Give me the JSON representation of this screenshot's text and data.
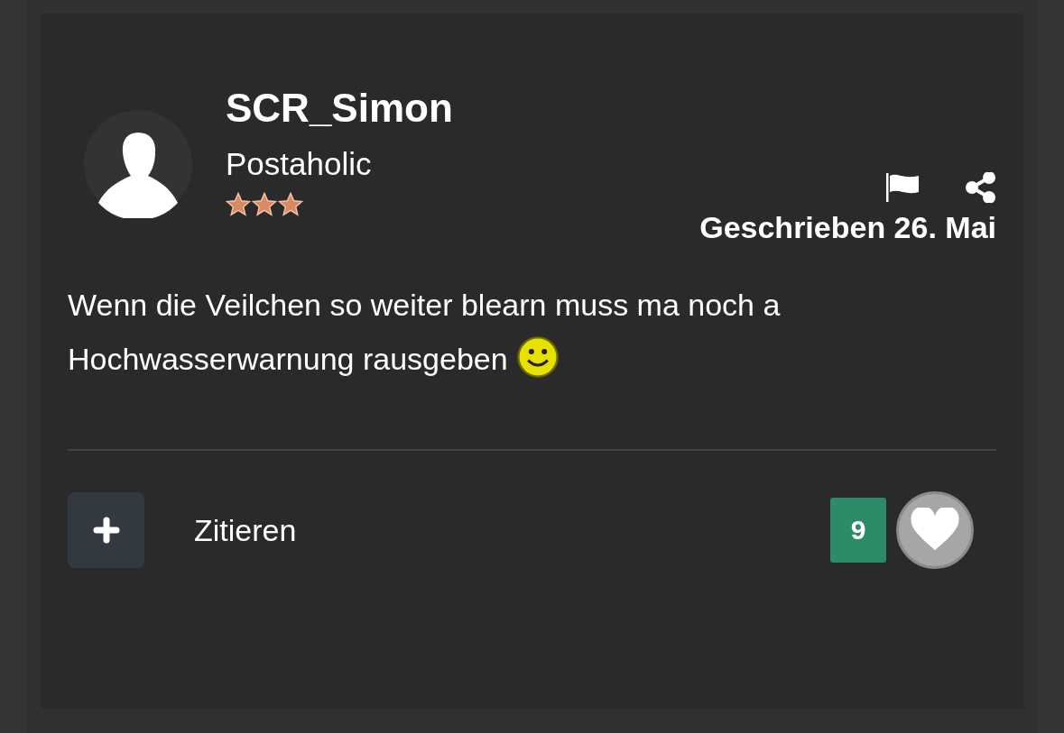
{
  "post": {
    "author": "SCR_Simon",
    "rank": "Postaholic",
    "stars": 3,
    "date": "Geschrieben 26. Mai",
    "text": "Wenn die Veilchen so weiter blearn muss ma noch a Hochwasserwarnung rausgeben"
  },
  "footer": {
    "quote_label": "Zitieren",
    "like_count": "9"
  }
}
